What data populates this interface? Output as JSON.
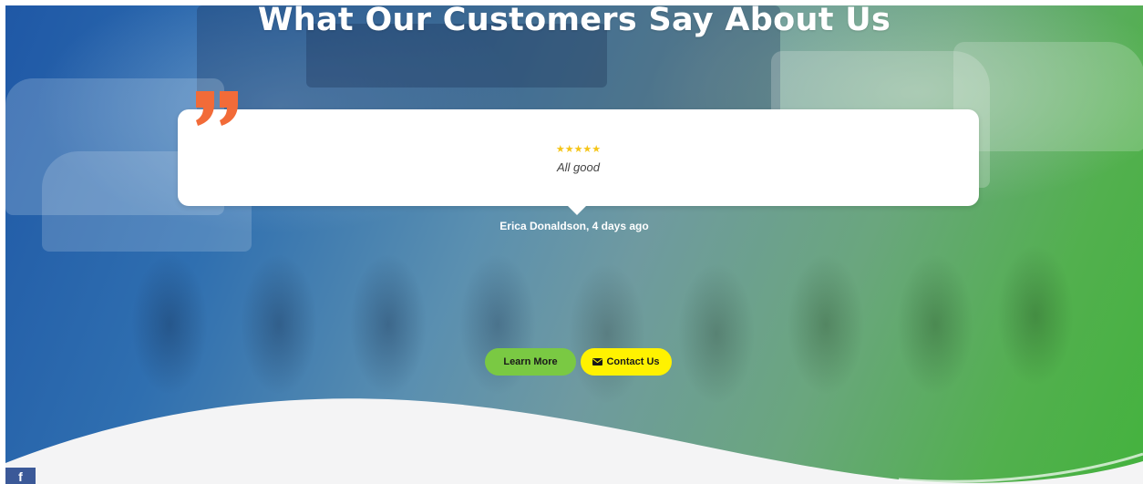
{
  "section": {
    "title": "What Our Customers Say About Us"
  },
  "testimonial": {
    "stars": "★★★★★",
    "rating": 5,
    "text": "All good",
    "reviewer": "Erica Donaldson,  4 days ago"
  },
  "buttons": {
    "learn_more": "Learn More",
    "contact_us": "Contact Us"
  },
  "social": {
    "facebook_glyph": "f"
  },
  "colors": {
    "quote_mark": "#f26b38",
    "stars": "#f5c518",
    "learn_more_bg": "#7ac943",
    "contact_bg": "#fff200",
    "hero_blue": "#1f58a6",
    "hero_green": "#44b23e",
    "facebook": "#3b5998"
  },
  "icons": {
    "quote": "quote-mark-icon",
    "envelope": "envelope-icon",
    "facebook": "facebook-icon"
  }
}
